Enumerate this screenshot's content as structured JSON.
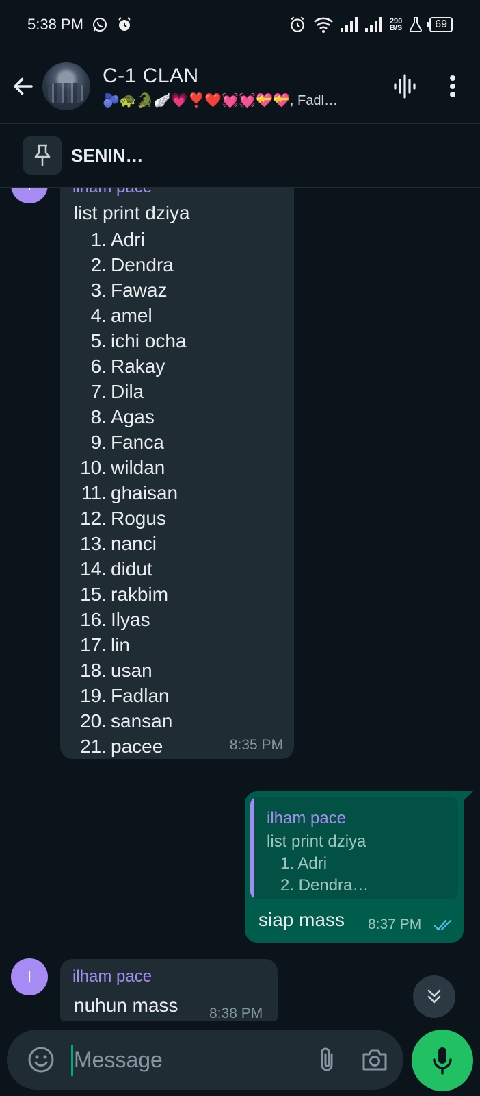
{
  "status_bar": {
    "time": "5:38 PM",
    "net_speed_value": "290",
    "net_speed_unit": "B/S",
    "battery": "69"
  },
  "header": {
    "group_name": "C-1 CLAN",
    "members": "🫐🐢🐊🪽💗❣️❤️💓💓💝💝, Fadl…"
  },
  "pinned": {
    "text": "SENIN…"
  },
  "messages": [
    {
      "avatar_letter": "I",
      "sender": "ilham pace",
      "title": "list print dziya",
      "list": [
        {
          "num": "1.",
          "name": "Adri"
        },
        {
          "num": "2.",
          "name": "Dendra"
        },
        {
          "num": "3.",
          "name": "Fawaz"
        },
        {
          "num": "4.",
          "name": "amel"
        },
        {
          "num": "5.",
          "name": "ichi ocha"
        },
        {
          "num": "6.",
          "name": "Rakay"
        },
        {
          "num": "7.",
          "name": "Dila"
        },
        {
          "num": "8.",
          "name": "Agas"
        },
        {
          "num": "9.",
          "name": "Fanca"
        },
        {
          "num": "10.",
          "name": "wildan"
        },
        {
          "num": "11.",
          "name": "ghaisan"
        },
        {
          "num": "12.",
          "name": "Rogus"
        },
        {
          "num": "13.",
          "name": "nanci"
        },
        {
          "num": "14.",
          "name": "didut"
        },
        {
          "num": "15.",
          "name": "rakbim"
        },
        {
          "num": "16.",
          "name": "Ilyas"
        },
        {
          "num": "17.",
          "name": "lin"
        },
        {
          "num": "18.",
          "name": "usan"
        },
        {
          "num": "19.",
          "name": "Fadlan"
        },
        {
          "num": "20.",
          "name": "sansan"
        },
        {
          "num": "21.",
          "name": "pacee"
        }
      ],
      "time": "8:35 PM"
    },
    {
      "quote_sender": "ilham pace",
      "quote_title": "list print dziya",
      "quote_line1": "1. Adri",
      "quote_line2": "2. Dendra…",
      "text": "siap mass",
      "time": "8:37 PM"
    },
    {
      "avatar_letter": "I",
      "sender": "ilham pace",
      "text": "nuhun mass",
      "time": "8:38 PM"
    }
  ],
  "composer": {
    "placeholder": "Message"
  },
  "colors": {
    "background": "#0b141a",
    "incoming_bubble": "#202c33",
    "outgoing_bubble": "#005c4b",
    "sender_name": "#a48bf0",
    "mic_button": "#21c063",
    "read_ticks": "#53bdeb"
  },
  "icons": {
    "back": "arrow-left-icon",
    "voice_chat": "waveform-icon",
    "menu": "more-vert-icon",
    "pin": "pin-icon",
    "emoji": "emoji-icon",
    "attach": "paperclip-icon",
    "camera": "camera-icon",
    "mic": "mic-icon",
    "scroll": "double-chevron-down-icon",
    "read": "double-check-icon"
  }
}
